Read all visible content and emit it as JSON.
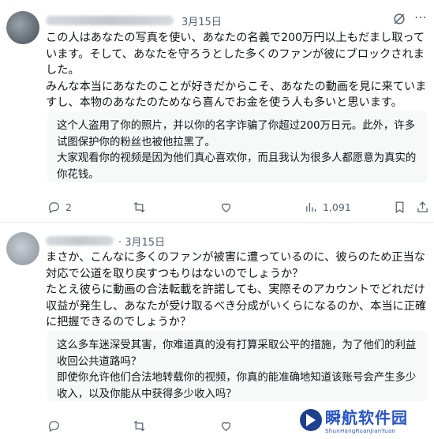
{
  "tweets": [
    {
      "date": "3月15日",
      "body": [
        "この人はあなたの写真を使い、あなたの名義で200万円以上もだまし取っています。そして、あなたを守ろうとした多くのファンが彼にブロックされました。",
        "みんな本当にあなたのことが好きだからこそ、あなたの動画を見に来ていますし、本物のあなたのためなら喜んでお金を使う人も多いと思います。"
      ],
      "translation": [
        "这个人盗用了你的照片，并以你的名字诈骗了你超过200万日元。此外，许多试图保护你的粉丝也被他拉黑了。",
        "大家观看你的视频是因为他们真心喜欢你，而且我认为很多人都愿意为真实的你花钱。"
      ],
      "stats": {
        "replies": "2",
        "retweets": "",
        "likes": "",
        "views": "1,091"
      }
    },
    {
      "date": "· 3月15日",
      "body": [
        "まさか、こんなに多くのファンが被害に遭っているのに、彼らのため正当な対応で公道を取り戻すつもりはないのでしょうか？",
        "たとえ彼らに動画の合法転載を許諾しても、実際そのアカウントでどれだけ収益が発生し、あなたが受け取るべき分成がいくらになるのか、本当に正確に把握できるのでしょうか？"
      ],
      "translation": [
        "这么多车迷深受其害，你难道真的没有打算采取公平的措施，为了他们的利益收回公共道路吗？",
        "即使你允许他们合法地转载你的视频，你真的能准确地知道该账号会产生多少收入，以及你能从中获得多少收入吗？"
      ],
      "stats": {
        "replies": "",
        "retweets": "",
        "likes": "",
        "views": ""
      }
    }
  ],
  "icons": {
    "reply": "reply-icon",
    "retweet": "retweet-icon",
    "like": "heart-icon",
    "views": "views-icon",
    "bookmark": "bookmark-icon",
    "share": "share-icon",
    "grok": "grok-icon",
    "more": "more-icon"
  },
  "colors": {
    "text": "#0f1419",
    "secondary": "#536471",
    "translation_bg": "#f7f9f9",
    "watermark": "#2a55c8"
  },
  "watermark": {
    "main": "瞬航软件园",
    "sub": "ShunHangRuanJianYuan"
  }
}
